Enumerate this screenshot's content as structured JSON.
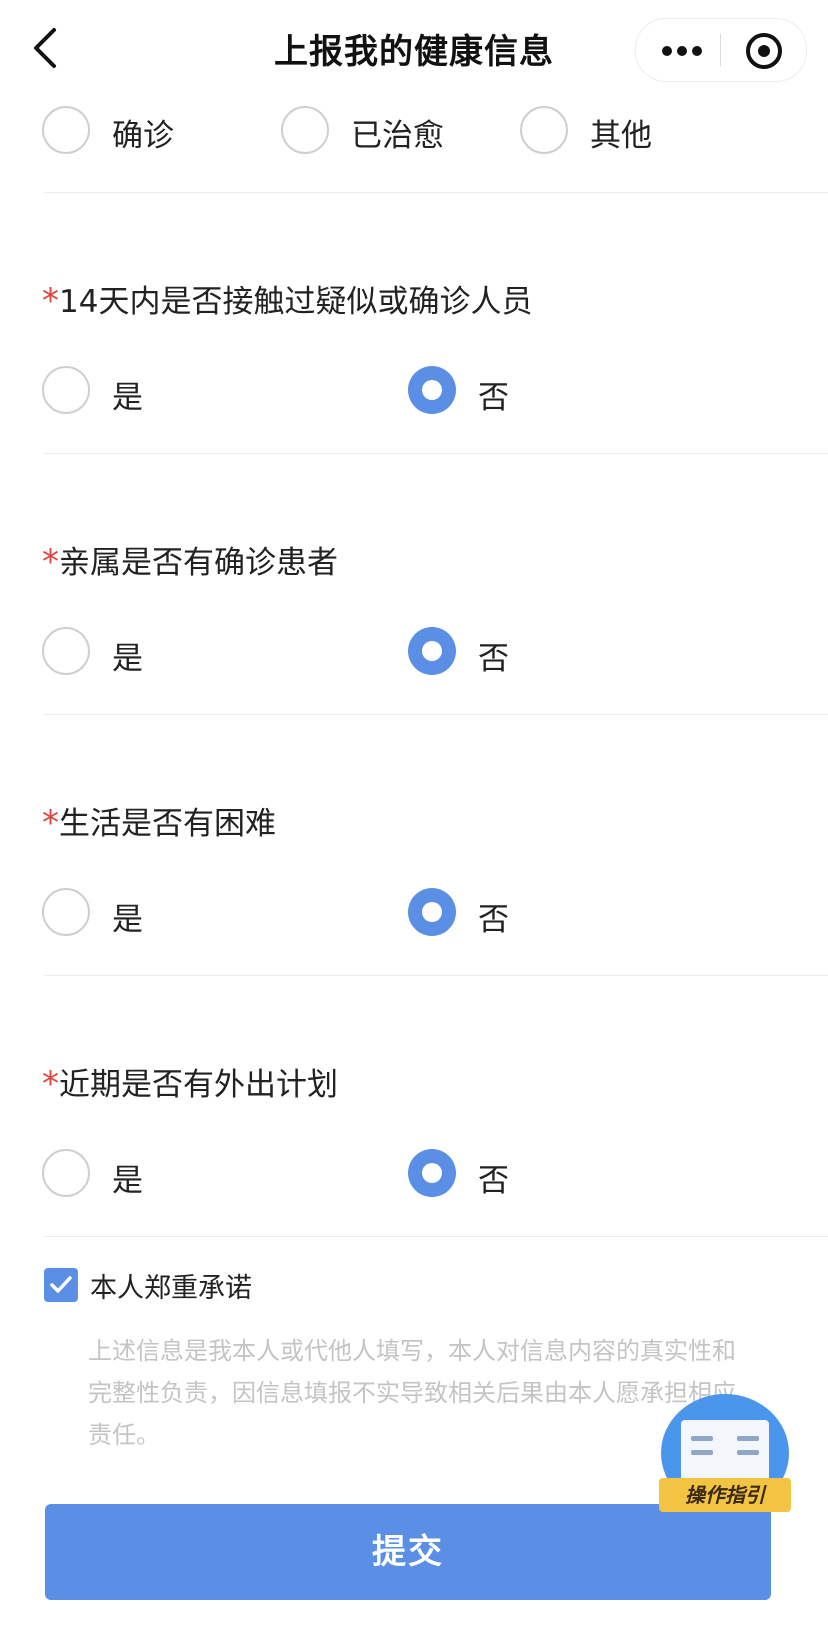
{
  "nav": {
    "title": "上报我的健康信息"
  },
  "status_options": [
    "确诊",
    "已治愈",
    "其他"
  ],
  "questions": [
    {
      "label": "14天内是否接触过疑似或确诊人员",
      "yes": "是",
      "no": "否",
      "selected": "否"
    },
    {
      "label": "亲属是否有确诊患者",
      "yes": "是",
      "no": "否",
      "selected": "否"
    },
    {
      "label": "生活是否有困难",
      "yes": "是",
      "no": "否",
      "selected": "否"
    },
    {
      "label": "近期是否有外出计划",
      "yes": "是",
      "no": "否",
      "selected": "否"
    }
  ],
  "required_mark": "*",
  "pledge": {
    "checked": true,
    "label": "本人郑重承诺",
    "text": "上述信息是我本人或代他人填写，本人对信息内容的真实性和完整性负责，因信息填报不实导致相关后果由本人愿承担相应责任。"
  },
  "guide": {
    "label": "操作指引"
  },
  "submit_label": "提交",
  "colors": {
    "accent": "#5b8fe6",
    "required": "#e0443b",
    "badge": "#f3c343"
  }
}
